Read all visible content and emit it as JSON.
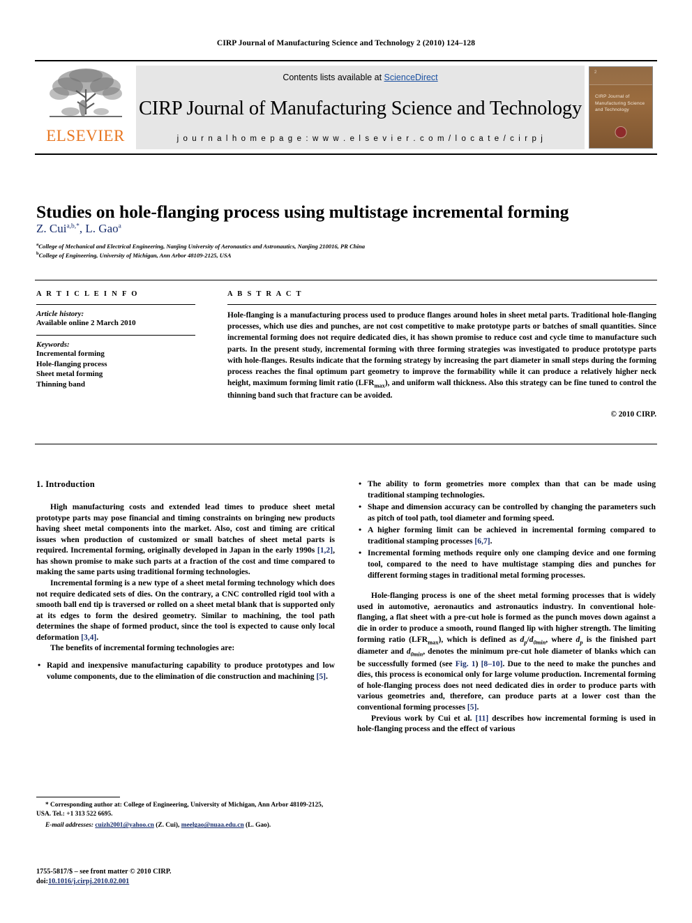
{
  "running_head": "CIRP Journal of Manufacturing Science and Technology 2 (2010) 124–128",
  "masthead": {
    "publisher": "ELSEVIER",
    "contents_prefix": "Contents lists available at ",
    "sciencedirect": "ScienceDirect",
    "journal_title": "CIRP Journal of Manufacturing Science and Technology",
    "homepage": "j o u r n a l   h o m e p a g e :   w w w . e l s e v i e r . c o m / l o c a t e / c i r p j",
    "cover": {
      "issue_number": "2",
      "title": "CIRP Journal of Manufacturing Science and Technology"
    },
    "link_color": "#1a4fa0",
    "brand_color": "#E87722"
  },
  "article": {
    "title": "Studies on hole-flanging process using multistage incremental forming",
    "authors_plain": "Z. Cui",
    "author1": "Z. Cui",
    "author1_sup": "a,b,*",
    "author2": ", L. Gao",
    "author2_sup": "a",
    "affiliation_a_sup": "a",
    "affiliation_a": "College of Mechanical and Electrical Engineering, Nanjing University of Aeronautics and Astronautics, Nanjing 210016, PR China",
    "affiliation_b_sup": "b",
    "affiliation_b": "College of Engineering, University of Michigan, Ann Arbor 48109-2125, USA"
  },
  "article_info": {
    "heading": "A R T I C L E   I N F O",
    "history_label": "Article history:",
    "history_value": "Available online 2 March 2010",
    "keywords_label": "Keywords:",
    "keywords": [
      "Incremental forming",
      "Hole-flanging process",
      "Sheet metal forming",
      "Thinning band"
    ]
  },
  "abstract": {
    "heading": "A B S T R A C T",
    "body_part1": "Hole-flanging is a manufacturing process used to produce flanges around holes in sheet metal parts. Traditional hole-flanging processes, which use dies and punches, are not cost competitive to make prototype parts or batches of small quantities. Since incremental forming does not require dedicated dies, it has shown promise to reduce cost and cycle time to manufacture such parts. In the present study, incremental forming with three forming strategies was investigated to produce prototype parts with hole-flanges. Results indicate that the forming strategy by increasing the part diameter in small steps during the forming process reaches the final optimum part geometry to improve the formability while it can produce a relatively higher neck height, maximum forming limit ratio (LFR",
    "body_sub": "max",
    "body_part2": "), and uniform wall thickness. Also this strategy can be fine tuned to control the thinning band such that fracture can be avoided.",
    "copyright": "© 2010 CIRP."
  },
  "body": {
    "section1_heading": "1. Introduction",
    "left_para1_a": "High manufacturing costs and extended lead times to produce sheet metal prototype parts may pose financial and timing constraints on bringing new products having sheet metal components into the market. Also, cost and timing are critical issues when production of customized or small batches of sheet metal parts is required. Incremental forming, originally developed in Japan in the early 1990s ",
    "left_para1_ref": "[1,2]",
    "left_para1_b": ", has shown promise to make such parts at a fraction of the cost and time compared to making the same parts using traditional forming technologies.",
    "left_para2_a": "Incremental forming is a new type of a sheet metal forming technology which does not require dedicated sets of dies. On the contrary, a CNC controlled rigid tool with a smooth ball end tip is traversed or rolled on a sheet metal blank that is supported only at its edges to form the desired geometry. Similar to machining, the tool path determines the shape of formed product, since the tool is expected to cause only local deformation ",
    "left_para2_ref": "[3,4]",
    "left_para2_b": ".",
    "left_para3": "The benefits of incremental forming technologies are:",
    "left_bullet1_a": "Rapid and inexpensive manufacturing capability to produce prototypes and low volume components, due to the elimination of die construction and machining ",
    "left_bullet1_ref": "[5]",
    "left_bullet1_b": ".",
    "right_bullet1": "The ability to form geometries more complex than that can be made using traditional stamping technologies.",
    "right_bullet2": "Shape and dimension accuracy can be controlled by changing the parameters such as pitch of tool path, tool diameter and forming speed.",
    "right_bullet3_a": "A higher forming limit can be achieved in incremental forming compared to traditional stamping processes ",
    "right_bullet3_ref": "[6,7]",
    "right_bullet3_b": ".",
    "right_bullet4": "Incremental forming methods require only one clamping device and one forming tool, compared to the need to have multistage stamping dies and punches for different forming stages in traditional metal forming processes.",
    "right_para1_a": "Hole-flanging process is one of the sheet metal forming processes that is widely used in automotive, aeronautics and astronautics industry. In conventional hole-flanging, a flat sheet with a pre-cut hole is formed as the punch moves down against a die in order to produce a smooth, round flanged lip with higher strength. The limiting forming ratio (LFR",
    "right_para1_sub1": "max",
    "right_para1_b": "), which is defined as ",
    "right_para1_dp": "d",
    "right_para1_dp_sub": "p",
    "right_para1_slash": "/",
    "right_para1_d0": "d",
    "right_para1_d0_sub": "0min",
    "right_para1_c": ", where ",
    "right_para1_dp2": "d",
    "right_para1_dp2_sub": "p",
    "right_para1_d": " is the finished part diameter and ",
    "right_para1_d0b": "d",
    "right_para1_d0b_sub": "0min",
    "right_para1_e": ", denotes the minimum pre-cut hole diameter of blanks which can be successfully formed (see ",
    "right_para1_fig": "Fig. 1",
    "right_para1_f": ") ",
    "right_para1_ref2": "[8–10]",
    "right_para1_g": ". Due to the need to make the punches and dies, this process is economical only for large volume production. Incremental forming of hole-flanging process does not need dedicated dies in order to produce parts with various geometries and, therefore, can produce parts at a lower cost than the conventional forming processes ",
    "right_para1_ref3": "[5]",
    "right_para1_h": ".",
    "right_para2_a": "Previous work by Cui et al. ",
    "right_para2_ref": "[11]",
    "right_para2_b": " describes how incremental forming is used in hole-flanging process and the effect of various"
  },
  "footnotes": {
    "corresponding_star": "*",
    "corresponding": " Corresponding author at: College of Engineering, University of Michigan, Ann Arbor 48109-2125, USA. Tel.: +1 313 522 6695.",
    "email_label": "E-mail addresses:",
    "email1": "cuizh2001@yahoo.cn",
    "email1_name": " (Z. Cui), ",
    "email2": "meelgao@nuaa.edu.cn",
    "email2_name": " (L. Gao)."
  },
  "footer": {
    "front_matter": "1755-5817/$ – see front matter © 2010 CIRP.",
    "doi_label": "doi:",
    "doi_value": "10.1016/j.cirpj.2010.02.001"
  }
}
